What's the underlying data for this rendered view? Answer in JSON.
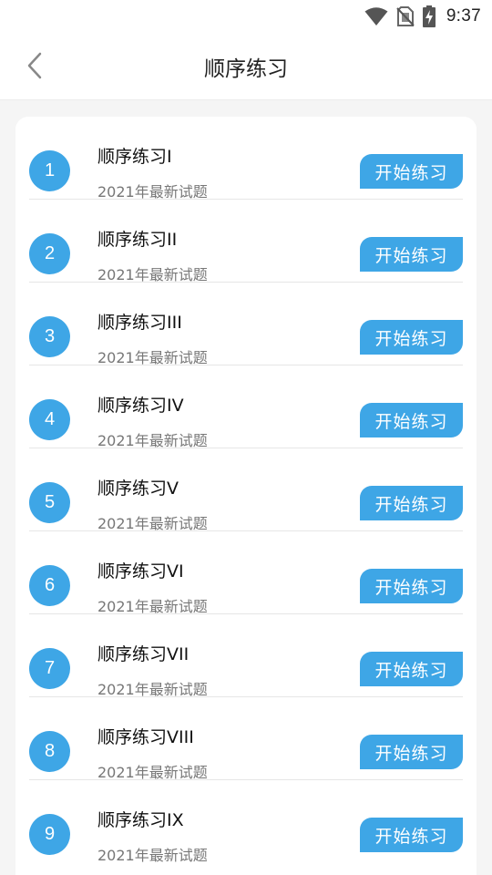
{
  "status_bar": {
    "time": "9:37",
    "icons": [
      "wifi-icon",
      "no-sim-icon",
      "battery-charging-icon"
    ]
  },
  "header": {
    "title": "顺序练习",
    "back_icon": "chevron-left-icon"
  },
  "colors": {
    "accent": "#3ea6e6",
    "title_text": "#111111",
    "subtitle_text": "#777777"
  },
  "practice_list": [
    {
      "number": "1",
      "title": "顺序练习I",
      "subtitle": "2021年最新试题",
      "button": "开始练习"
    },
    {
      "number": "2",
      "title": "顺序练习II",
      "subtitle": "2021年最新试题",
      "button": "开始练习"
    },
    {
      "number": "3",
      "title": "顺序练习III",
      "subtitle": "2021年最新试题",
      "button": "开始练习"
    },
    {
      "number": "4",
      "title": "顺序练习IV",
      "subtitle": "2021年最新试题",
      "button": "开始练习"
    },
    {
      "number": "5",
      "title": "顺序练习V",
      "subtitle": "2021年最新试题",
      "button": "开始练习"
    },
    {
      "number": "6",
      "title": "顺序练习VI",
      "subtitle": "2021年最新试题",
      "button": "开始练习"
    },
    {
      "number": "7",
      "title": "顺序练习VII",
      "subtitle": "2021年最新试题",
      "button": "开始练习"
    },
    {
      "number": "8",
      "title": "顺序练习VIII",
      "subtitle": "2021年最新试题",
      "button": "开始练习"
    },
    {
      "number": "9",
      "title": "顺序练习IX",
      "subtitle": "2021年最新试题",
      "button": "开始练习"
    }
  ]
}
